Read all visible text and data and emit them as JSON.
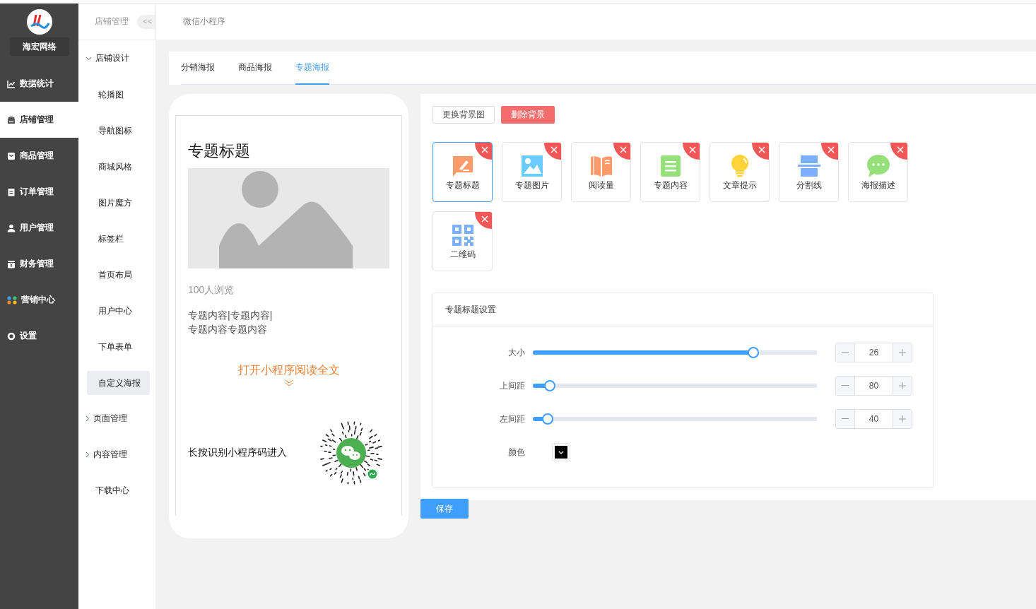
{
  "sidebar": {
    "brand": "海宏网络",
    "items": [
      {
        "label": "数据统计",
        "selected": false
      },
      {
        "label": "店铺管理",
        "selected": true
      },
      {
        "label": "商品管理",
        "selected": false
      },
      {
        "label": "订单管理",
        "selected": false
      },
      {
        "label": "用户管理",
        "selected": false
      },
      {
        "label": "财务管理",
        "selected": false
      },
      {
        "label": "营销中心",
        "selected": false
      },
      {
        "label": "设置",
        "selected": false
      }
    ]
  },
  "submenu": {
    "title": "店铺管理",
    "collapse_button": "<<",
    "groups": [
      {
        "label": "店铺设计",
        "kind": "group",
        "expanded": true,
        "children": [
          {
            "label": "轮播图",
            "selected": false
          },
          {
            "label": "导航图标",
            "selected": false
          },
          {
            "label": "商城风格",
            "selected": false
          },
          {
            "label": "图片魔方",
            "selected": false
          },
          {
            "label": "标签栏",
            "selected": false
          },
          {
            "label": "首页布局",
            "selected": false
          },
          {
            "label": "用户中心",
            "selected": false
          },
          {
            "label": "下单表单",
            "selected": false
          },
          {
            "label": "自定义海报",
            "selected": true
          }
        ]
      },
      {
        "label": "页面管理",
        "kind": "group",
        "expanded": false
      },
      {
        "label": "内容管理",
        "kind": "group",
        "expanded": false
      },
      {
        "label": "下载中心",
        "kind": "link"
      }
    ]
  },
  "topbar": {
    "title": "微信小程序"
  },
  "tabs": [
    {
      "label": "分销海报",
      "selected": false
    },
    {
      "label": "商品海报",
      "selected": false
    },
    {
      "label": "专题海报",
      "selected": true
    }
  ],
  "preview": {
    "title": "专题标题",
    "reads": "100人浏览",
    "content_lines": [
      "专题内容|专题内容|",
      "专题内容专题内容"
    ],
    "open_link": "打开小程序阅读全文",
    "qr_hint": "长按识别小程序码进入"
  },
  "background_buttons": [
    {
      "label": "更换背景图",
      "kind": "default"
    },
    {
      "label": "删除背景",
      "kind": "danger"
    }
  ],
  "widgets": [
    {
      "label": "专题标题",
      "selected": true
    },
    {
      "label": "专题图片",
      "selected": false
    },
    {
      "label": "阅读量",
      "selected": false
    },
    {
      "label": "专题内容",
      "selected": false
    },
    {
      "label": "文章提示",
      "selected": false
    },
    {
      "label": "分割线",
      "selected": false
    },
    {
      "label": "海报描述",
      "selected": false
    },
    {
      "label": "二维码",
      "selected": false
    }
  ],
  "settings": {
    "title": "专题标题设置",
    "sliders": [
      {
        "label": "大小",
        "level": 0.776,
        "value": "26"
      },
      {
        "label": "上间距",
        "level": 0.06,
        "value": "80"
      },
      {
        "label": "左间距",
        "level": 0.052,
        "value": "40"
      }
    ],
    "color": {
      "label": "颜色",
      "color": "#000000"
    }
  },
  "save_button": "保存"
}
